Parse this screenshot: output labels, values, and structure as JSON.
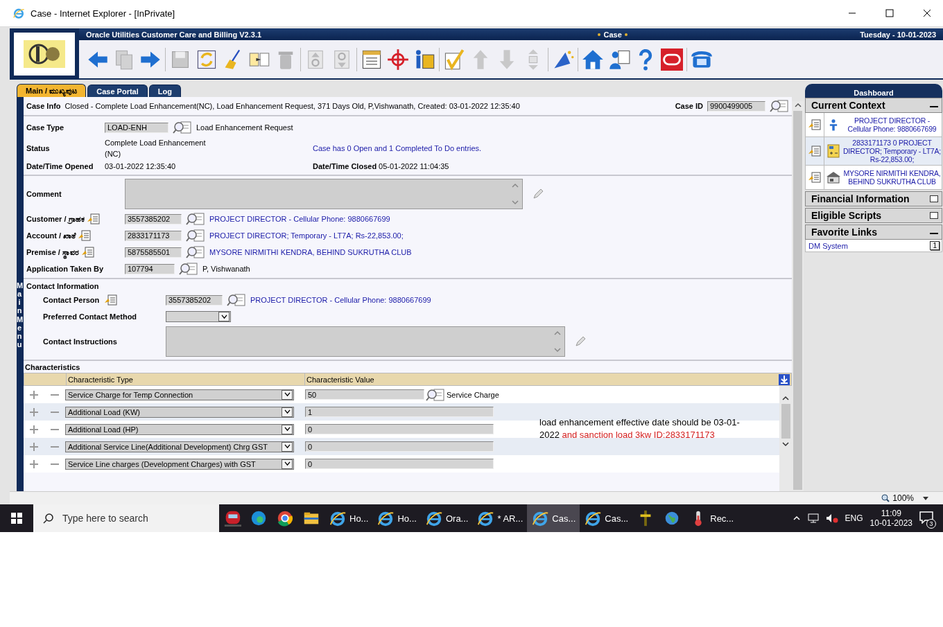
{
  "window": {
    "title": "Case - Internet Explorer - [InPrivate]"
  },
  "header": {
    "product": "Oracle Utilities Customer Care and Billing V2.3.1",
    "page": "Case",
    "date": "Tuesday - 10-01-2023"
  },
  "toolbar": [
    {
      "buttons": [
        {
          "kind": "back",
          "disabled": false
        },
        {
          "kind": "copy",
          "disabled": true
        },
        {
          "kind": "forward",
          "disabled": false
        }
      ]
    },
    {
      "buttons": [
        {
          "kind": "save",
          "disabled": true
        },
        {
          "kind": "refresh",
          "disabled": false
        },
        {
          "kind": "clear",
          "disabled": false
        },
        {
          "kind": "duplicate",
          "disabled": false
        },
        {
          "kind": "delete",
          "disabled": true
        }
      ]
    },
    {
      "buttons": [
        {
          "kind": "goto-up",
          "disabled": true
        },
        {
          "kind": "goto-down",
          "disabled": true
        }
      ]
    },
    {
      "buttons": [
        {
          "kind": "list",
          "disabled": false
        },
        {
          "kind": "target",
          "disabled": false
        },
        {
          "kind": "info",
          "disabled": false
        }
      ]
    },
    {
      "buttons": [
        {
          "kind": "check",
          "disabled": false
        },
        {
          "kind": "up",
          "disabled": true
        },
        {
          "kind": "down",
          "disabled": true
        },
        {
          "kind": "bounds",
          "disabled": true
        }
      ]
    },
    {
      "buttons": [
        {
          "kind": "magic",
          "disabled": false
        }
      ]
    },
    {
      "buttons": [
        {
          "kind": "home",
          "disabled": false
        },
        {
          "kind": "person",
          "disabled": false
        },
        {
          "kind": "help",
          "disabled": false
        },
        {
          "kind": "oracle",
          "disabled": false
        }
      ]
    },
    {
      "buttons": [
        {
          "kind": "phone",
          "disabled": false
        }
      ]
    }
  ],
  "tabs": [
    {
      "label": "Main / ಮುಖ್ಯಪುಟ",
      "selected": true
    },
    {
      "label": "Case Portal",
      "selected": false
    },
    {
      "label": "Log",
      "selected": false
    }
  ],
  "main_menu": "Main Menu",
  "case_info": {
    "label": "Case Info",
    "text": "Closed - Complete Load Enhancement(NC), Load Enhancement Request, 371 Days Old, P,Vishwanath, Created: 03-01-2022 12:35:40",
    "case_id_label": "Case ID",
    "case_id": "9900499005"
  },
  "case_type": {
    "label": "Case Type",
    "value": "LOAD-ENH",
    "description": "Load Enhancement Request"
  },
  "status": {
    "label": "Status",
    "value": "Complete Load Enhancement (NC)",
    "todo_summary": "Case has 0 Open and 1 Completed To Do entries."
  },
  "date_opened": {
    "label": "Date/Time Opened",
    "value": "03-01-2022 12:35:40"
  },
  "date_closed": {
    "label": "Date/Time Closed",
    "value": "05-01-2022 11:04:35"
  },
  "comment": {
    "label": "Comment"
  },
  "references": [
    {
      "kind": "customer",
      "label": "Customer / ಗ್ರಾಹಕ",
      "value": "3557385202",
      "description": "PROJECT DIRECTOR -  Cellular Phone:  9880667699"
    },
    {
      "kind": "account",
      "label": "Account / ಖಾತೆ",
      "value": "2833171173",
      "description": "PROJECT DIRECTOR; Temporary - LT7A; Rs-22,853.00;"
    },
    {
      "kind": "premise",
      "label": "Premise / ಸ್ಥಾವರ",
      "value": "5875585501",
      "description": "MYSORE NIRMITHI KENDRA, BEHIND SUKRUTHA CLUB"
    },
    {
      "kind": "user",
      "label": "Application Taken By",
      "value": "107794",
      "description": "P, Vishwanath"
    }
  ],
  "contact": {
    "title": "Contact Information",
    "person_label": "Contact Person",
    "person_value": "3557385202",
    "person_description": "PROJECT DIRECTOR -  Cellular Phone:  9880667699",
    "method_label": "Preferred Contact Method",
    "instructions_label": "Contact Instructions"
  },
  "characteristics": {
    "title": "Characteristics",
    "columns": [
      "Characteristic Type",
      "Characteristic Value"
    ],
    "rows": [
      {
        "type": "Service Charge for Temp Connection",
        "value": "50",
        "description": "Service Charge"
      },
      {
        "type": "Additional Load (KW)",
        "value": "1"
      },
      {
        "type": "Additional Load (HP)",
        "value": "0"
      },
      {
        "type": "Additional Service Line(Additional Development) Chrg GST",
        "value": "0"
      },
      {
        "type": "Service Line charges (Development Charges) with GST",
        "value": "0"
      }
    ]
  },
  "note": {
    "text": "load enhancement effective date should be 03-01-2022",
    "highlight": "and sanction load 3kw ID:2833171173"
  },
  "dashboard": {
    "title": "Dashboard",
    "sections": [
      {
        "title": "Current Context",
        "expanded": true,
        "items": [
          {
            "kind": "person",
            "text": "PROJECT DIRECTOR - Cellular Phone: 9880667699"
          },
          {
            "kind": "account",
            "text": "2833171173 0 PROJECT DIRECTOR; Temporary - LT7A; Rs-22,853.00;"
          },
          {
            "kind": "premise",
            "text": "MYSORE NIRMITHI KENDRA, BEHIND SUKRUTHA CLUB"
          }
        ]
      },
      {
        "title": "Financial Information",
        "expanded": false
      },
      {
        "title": "Eligible Scripts",
        "expanded": false
      },
      {
        "title": "Favorite Links",
        "expanded": true,
        "links": [
          {
            "text": "DM System",
            "key": "1"
          }
        ]
      }
    ]
  },
  "status_bar": {
    "zoom": "100%"
  },
  "taskbar": {
    "search_placeholder": "Type here to search",
    "apps": [
      {
        "kind": "train",
        "selected": false
      },
      {
        "kind": "edge",
        "selected": false
      },
      {
        "kind": "chrome",
        "selected": false
      },
      {
        "kind": "folder",
        "selected": false
      },
      {
        "kind": "ie",
        "label": "Ho...",
        "selected": false
      },
      {
        "kind": "ie",
        "label": "Ho...",
        "selected": false
      },
      {
        "kind": "ie",
        "label": "Ora...",
        "selected": false
      },
      {
        "kind": "ie",
        "label": "* AR...",
        "selected": false
      },
      {
        "kind": "ie",
        "label": "Cas...",
        "selected": true
      },
      {
        "kind": "ie",
        "label": "Cas...",
        "selected": false
      },
      {
        "kind": "pin",
        "selected": false
      },
      {
        "kind": "globe",
        "selected": false
      },
      {
        "kind": "thermometer",
        "label": "Rec...",
        "selected": false
      }
    ],
    "language": "ENG",
    "time": "11:09",
    "date": "10-01-2023",
    "notifications": "3"
  }
}
